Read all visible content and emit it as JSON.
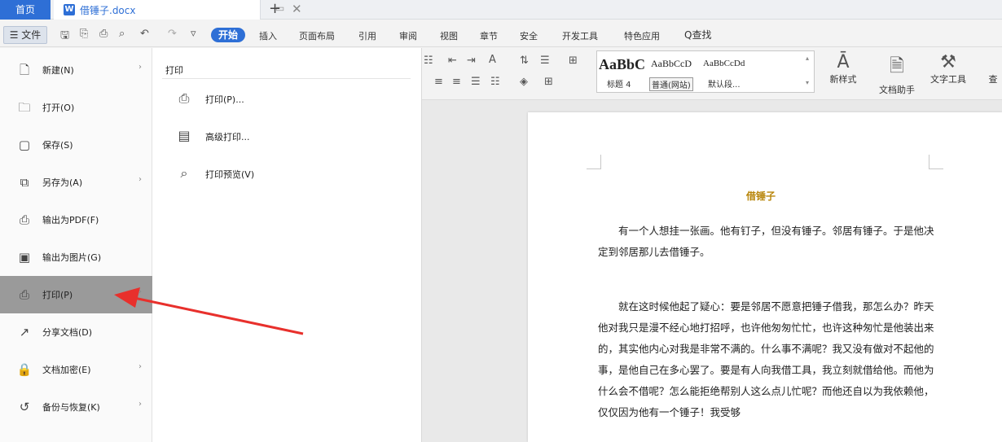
{
  "tabs": {
    "home": "首页",
    "doc_badge": "W",
    "doc_title": "借锤子.docx",
    "close": "✕",
    "add": "+"
  },
  "menubar": {
    "file": "☰ 文件",
    "start": "开始",
    "items": [
      "插入",
      "页面布局",
      "引用",
      "审阅",
      "视图",
      "章节",
      "安全",
      "开发工具",
      "特色应用"
    ],
    "search": "Q查找"
  },
  "ribbon": {
    "style_samples": [
      "AaBbC",
      "AaBbCcD",
      "AaBbCcDd"
    ],
    "style_labels": [
      "标题 4",
      "普通(网站)",
      "默认段..."
    ],
    "new_style": "新样式",
    "doc_assistant": "文档助手",
    "text_tools": "文字工具",
    "search_replace": "查"
  },
  "file_menu": {
    "items": [
      {
        "label": "新建(N)",
        "icon": "new-doc-icon",
        "glyph": "🗋",
        "arrow": true
      },
      {
        "label": "打开(O)",
        "icon": "open-folder-icon",
        "glyph": "🗀",
        "arrow": false
      },
      {
        "label": "保存(S)",
        "icon": "save-icon",
        "glyph": "▢",
        "arrow": false
      },
      {
        "label": "另存为(A)",
        "icon": "save-as-icon",
        "glyph": "⧉",
        "arrow": true
      },
      {
        "label": "输出为PDF(F)",
        "icon": "export-pdf-icon",
        "glyph": "⎙",
        "arrow": false
      },
      {
        "label": "输出为图片(G)",
        "icon": "export-image-icon",
        "glyph": "▣",
        "arrow": false
      },
      {
        "label": "打印(P)",
        "icon": "print-icon",
        "glyph": "⎙",
        "arrow": true,
        "active": true
      },
      {
        "label": "分享文档(D)",
        "icon": "share-icon",
        "glyph": "↗",
        "arrow": false
      },
      {
        "label": "文档加密(E)",
        "icon": "encrypt-icon",
        "glyph": "🔒",
        "arrow": true
      },
      {
        "label": "备份与恢复(K)",
        "icon": "backup-icon",
        "glyph": "↺",
        "arrow": true
      }
    ]
  },
  "print_submenu": {
    "title": "打印",
    "items": [
      {
        "label": "打印(P)...",
        "icon": "printer-icon",
        "glyph": "⎙"
      },
      {
        "label": "高级打印...",
        "icon": "advanced-print-icon",
        "glyph": "▤"
      },
      {
        "label": "打印预览(V)",
        "icon": "print-preview-icon",
        "glyph": "⌕"
      }
    ]
  },
  "document": {
    "heading": "借锤子",
    "paragraphs": [
      "　　有一个人想挂一张画。他有钉子，但没有锤子。邻居有锤子。于是他决定到邻居那儿去借锤子。",
      "　　就在这时候他起了疑心：要是邻居不愿意把锤子借我，那怎么办？昨天他对我只是漫不经心地打招呼，也许他匆匆忙忙，也许这种匆忙是他装出来的，其实他内心对我是非常不满的。什么事不满呢？我又没有做对不起他的事，是他自己在多心罢了。要是有人向我借工具，我立刻就借给他。而他为什么会不借呢？怎么能拒绝帮别人这么点儿忙呢？而他还自以为我依赖他，仅仅因为他有一个锤子！我受够"
    ]
  },
  "colors": {
    "accent": "#2e6fd6",
    "heading": "#b8860b",
    "active_item": "#9a9a9a",
    "arrow": "#e8302c"
  }
}
